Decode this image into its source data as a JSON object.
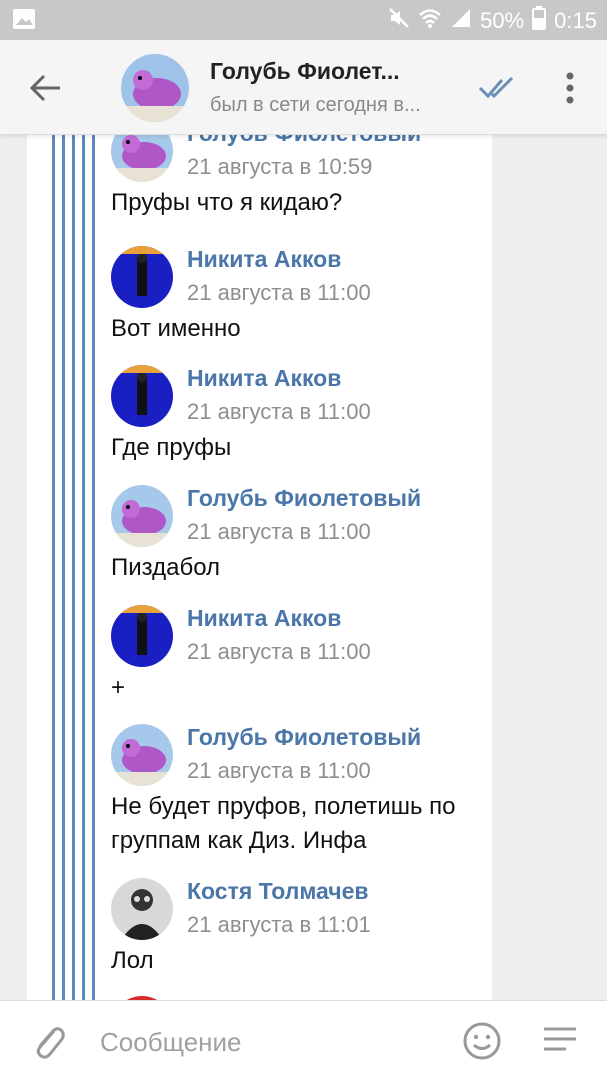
{
  "status_bar": {
    "battery": "50%",
    "time": "0:15"
  },
  "header": {
    "title": "Голубь Фиолет...",
    "subtitle": "был в сети сегодня в..."
  },
  "messages": [
    {
      "author": "Голубь Фиолетовый",
      "time": "21 августа в 10:59",
      "text": "Пруфы что я кидаю?",
      "avatar": "pigeon"
    },
    {
      "author": "Никита Акков",
      "time": "21 августа в 11:00",
      "text": "Вот именно",
      "avatar": "dark"
    },
    {
      "author": "Никита Акков",
      "time": "21 августа в 11:00",
      "text": "Где пруфы",
      "avatar": "dark"
    },
    {
      "author": "Голубь Фиолетовый",
      "time": "21 августа в 11:00",
      "text": "Пиздабол",
      "avatar": "pigeon"
    },
    {
      "author": "Никита Акков",
      "time": "21 августа в 11:00",
      "text": "+",
      "avatar": "dark"
    },
    {
      "author": "Голубь Фиолетовый",
      "time": "21 августа в 11:00",
      "text": "Не будет пруфов, полетишь по группам как Диз. Инфа",
      "avatar": "pigeon"
    },
    {
      "author": "Костя Толмачев",
      "time": "21 августа в 11:01",
      "text": "Лол",
      "avatar": "bw"
    }
  ],
  "composer": {
    "placeholder": "Сообщение"
  },
  "icons": [
    "image-icon",
    "mute-icon",
    "wifi-icon",
    "signal-icon",
    "battery-icon",
    "back-arrow-icon",
    "double-check-icon",
    "more-vertical-icon",
    "attach-icon",
    "emoji-icon",
    "menu-lines-icon"
  ],
  "colors": {
    "accent": "#4a76a8",
    "thread_line": "#5b88bd",
    "status_bar": "#c8c8c8"
  }
}
